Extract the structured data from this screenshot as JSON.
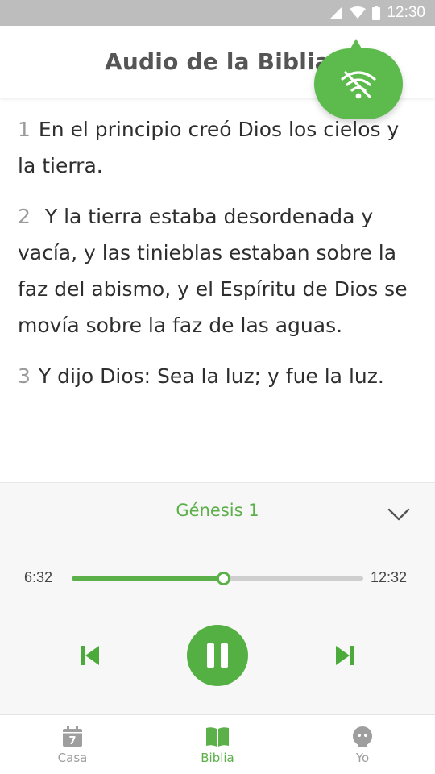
{
  "status_bar": {
    "time": "12:30"
  },
  "header": {
    "title": "Audio de la Biblia"
  },
  "verses": [
    {
      "num": "1",
      "text": "En el principio creó Dios los cielos y la tierra."
    },
    {
      "num": "2",
      "text": " Y la tierra estaba desordenada y vacía, y las tinieblas estaban sobre la faz del abismo, y el Espíritu de Dios se movía sobre la faz de las aguas."
    },
    {
      "num": "3",
      "text": "Y dijo Dios: Sea la luz; y fue la luz."
    }
  ],
  "player": {
    "title": "Génesis 1",
    "current_time": "6:32",
    "total_time": "12:32",
    "progress": 0.52
  },
  "nav": {
    "items": [
      {
        "label": "Casa",
        "icon": "calendar-icon",
        "calendar_day": "7",
        "active": false
      },
      {
        "label": "Biblia",
        "icon": "book-icon",
        "active": true
      },
      {
        "label": "Yo",
        "icon": "user-icon",
        "active": false
      }
    ]
  },
  "colors": {
    "accent": "#5cb04a",
    "status_bar": "#bdbdbd",
    "nav_inactive": "#9e9e9e"
  }
}
